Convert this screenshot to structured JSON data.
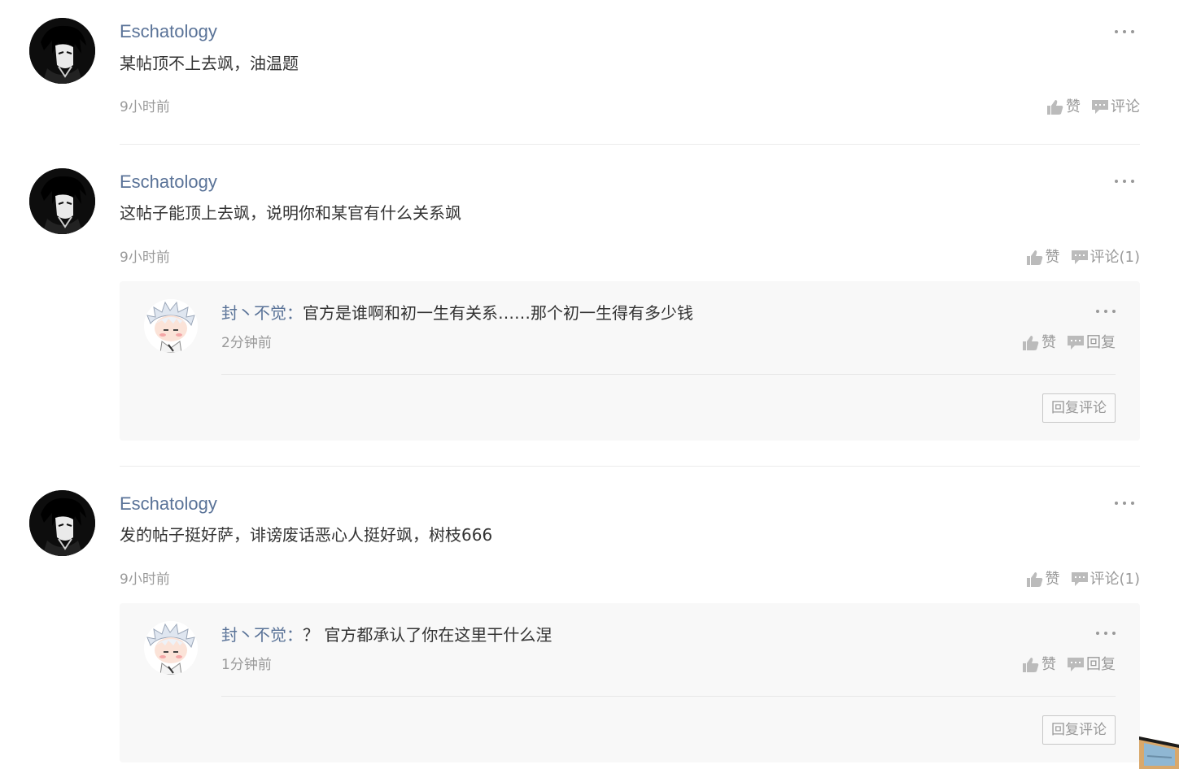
{
  "comments": [
    {
      "user": "Eschatology",
      "text": "某帖顶不上去飒，油温题",
      "time": "9小时前",
      "like_label": "赞",
      "comment_label": "评论",
      "replies": []
    },
    {
      "user": "Eschatology",
      "text": "这帖子能顶上去飒，说明你和某官有什么关系飒",
      "time": "9小时前",
      "like_label": "赞",
      "comment_label": "评论(1)",
      "replies": [
        {
          "user": "封丶不觉",
          "sep": "：",
          "text": "官方是谁啊和初一生有关系……那个初一生得有多少钱",
          "time": "2分钟前",
          "like_label": "赞",
          "reply_label": "回复",
          "reply_button": "回复评论"
        }
      ]
    },
    {
      "user": "Eschatology",
      "text": "发的帖子挺好萨，诽谤废话恶心人挺好飒，树枝666",
      "time": "9小时前",
      "like_label": "赞",
      "comment_label": "评论(1)",
      "replies": [
        {
          "user": "封丶不觉",
          "sep": "：",
          "text": "？ 官方都承认了你在这里干什么涅",
          "time": "1分钟前",
          "like_label": "赞",
          "reply_label": "回复",
          "reply_button": "回复评论"
        }
      ]
    }
  ],
  "icons": {
    "like": "thumbs-up-icon",
    "comment": "speech-bubble-icon",
    "more": "more-dots-icon"
  },
  "colors": {
    "username": "#5a7398",
    "muted": "#999999",
    "reply_bg": "#f8f8f8"
  }
}
